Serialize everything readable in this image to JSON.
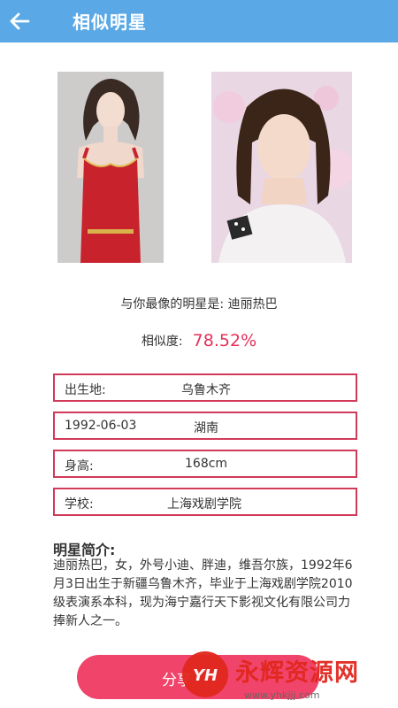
{
  "header": {
    "title": "相似明星",
    "back_icon": "arrow-left-icon"
  },
  "photos": {
    "left_desc": "user-photo",
    "right_desc": "star-photo"
  },
  "result": {
    "match_text": "与你最像的明星是:  迪丽热巴",
    "similarity_label": "相似度:",
    "similarity_value": "78.52%",
    "similarity_color": "#e62f5a"
  },
  "info_rows": [
    {
      "label": "出生地:",
      "value": "乌鲁木齐"
    },
    {
      "label": "1992-06-03",
      "value": "湖南"
    },
    {
      "label": "身高:",
      "value": "168cm"
    },
    {
      "label": "学校:",
      "value": "上海戏剧学院"
    }
  ],
  "intro": {
    "title": "明星简介:",
    "text": "迪丽热巴，女，外号小迪、胖迪，维吾尔族，1992年6月3日出生于新疆乌鲁木齐，毕业于上海戏剧学院2010级表演系本科，现为海宁嘉行天下影视文化有限公司力捧新人之一。"
  },
  "share_button": {
    "label": "分享",
    "color": "#f0446a"
  },
  "watermark": {
    "logo": "YH",
    "text": "永辉资源网",
    "url": "www.yhkjjj.com"
  },
  "colors": {
    "appbar": "#5aa9e6",
    "border": "#d23a5a"
  }
}
